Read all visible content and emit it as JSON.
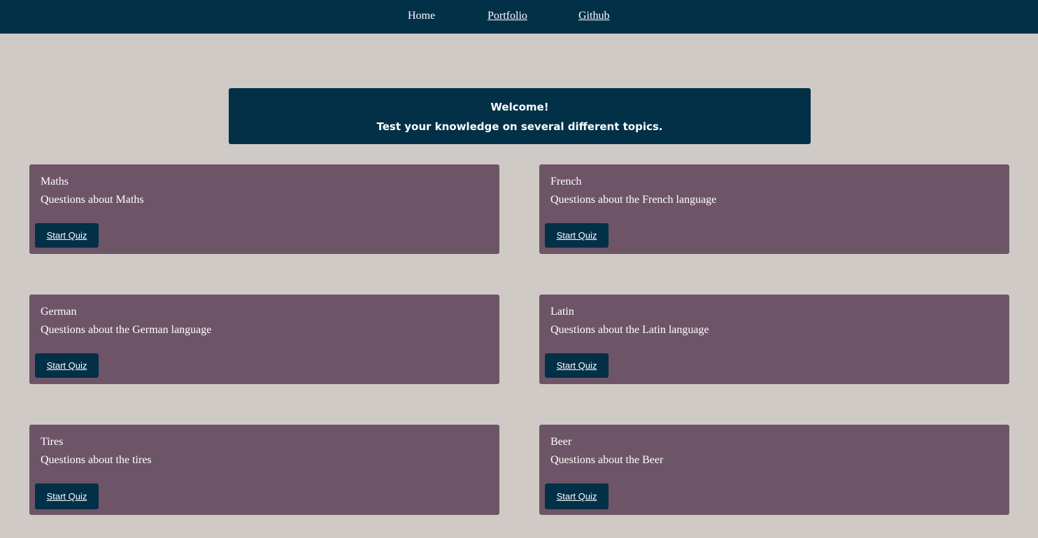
{
  "nav": {
    "home": "Home",
    "portfolio": "Portfolio",
    "github": "Github"
  },
  "welcome": {
    "line1": "Welcome!",
    "line2": "Test your knowledge on several different topics."
  },
  "quizzes": [
    {
      "title": "Maths",
      "description": "Questions about Maths",
      "button": "Start Quiz"
    },
    {
      "title": "French",
      "description": "Questions about the French language",
      "button": "Start Quiz"
    },
    {
      "title": "German",
      "description": "Questions about the German language",
      "button": "Start Quiz"
    },
    {
      "title": "Latin",
      "description": "Questions about the Latin language",
      "button": "Start Quiz"
    },
    {
      "title": "Tires",
      "description": "Questions about the tires",
      "button": "Start Quiz"
    },
    {
      "title": "Beer",
      "description": "Questions about the Beer",
      "button": "Start Quiz"
    }
  ],
  "colors": {
    "background": "#cfcac6",
    "navbar": "#023047",
    "card": "#6d5567",
    "button": "#023047",
    "text": "#ffffff"
  }
}
